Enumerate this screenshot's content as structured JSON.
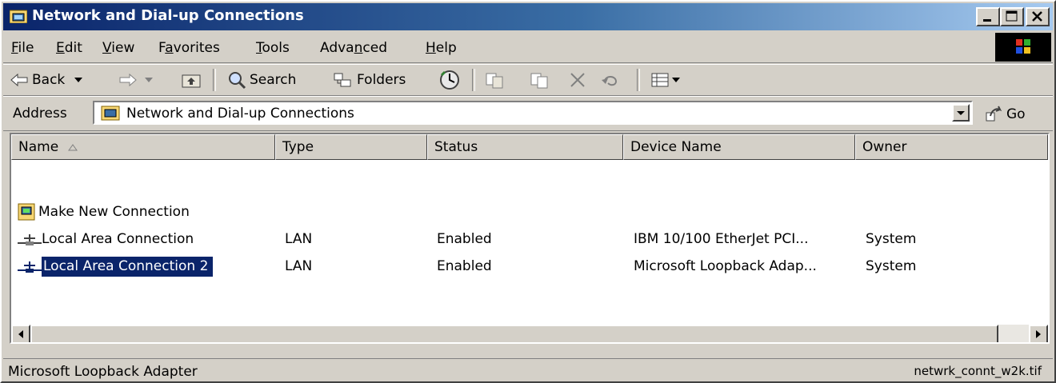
{
  "window": {
    "title": "Network and Dial-up Connections"
  },
  "menu": [
    "File",
    "Edit",
    "View",
    "Favorites",
    "Tools",
    "Advanced",
    "Help"
  ],
  "menu_underline": [
    "F",
    "E",
    "V",
    "a",
    "T",
    "n",
    "H"
  ],
  "toolbar": {
    "back_label": "Back",
    "search_label": "Search",
    "folders_label": "Folders"
  },
  "address": {
    "label": "Address",
    "value": "Network and Dial-up Connections",
    "go_label": "Go"
  },
  "columns": [
    "Name",
    "Type",
    "Status",
    "Device Name",
    "Owner"
  ],
  "rows": [
    {
      "name": "Make New Connection",
      "type": "",
      "status": "",
      "device": "",
      "owner": ""
    },
    {
      "name": "Local Area Connection",
      "type": "LAN",
      "status": "Enabled",
      "device": "IBM 10/100 EtherJet PCI...",
      "owner": "System"
    },
    {
      "name": "Local Area Connection 2",
      "type": "LAN",
      "status": "Enabled",
      "device": "Microsoft Loopback Adap...",
      "owner": "System"
    }
  ],
  "status": {
    "left": "Microsoft Loopback Adapter",
    "right": "netwrk_connt_w2k.tif"
  }
}
